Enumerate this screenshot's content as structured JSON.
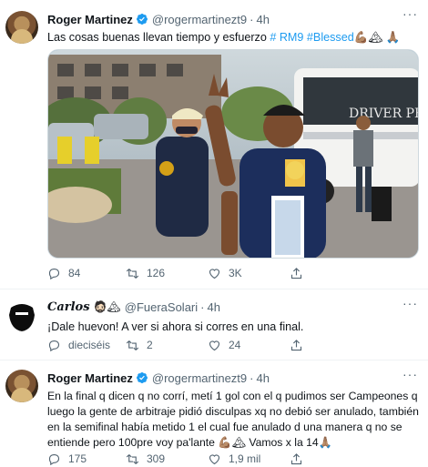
{
  "tweets": [
    {
      "name": "Roger Martinez",
      "handle": "@rogermartinezt9",
      "time": "4h",
      "text": "Las cosas buenas llevan tiempo y esfuerzo",
      "hashtags": "# RM9 #Blessed",
      "emojis": "💪🏽🏔 🙏🏽",
      "stats": {
        "replies": "84",
        "retweets": "126",
        "likes": "3K"
      }
    },
    {
      "name": "Carlos",
      "handle": "@FueraSolari",
      "time": "4h",
      "name_emojis": "🧔🏻🏔",
      "text": "¡Dale huevon! A ver si ahora si corres en una final.",
      "stats": {
        "replies": "dieciséis",
        "retweets": "2",
        "likes": "24"
      }
    },
    {
      "name": "Roger Martinez",
      "handle": "@rogermartinezt9",
      "time": "4h",
      "text_line1": "En la final q dicen q no corrí, metí 1 gol con el q pudimos ser Campeones q",
      "text_line2": "luego la gente de arbitraje pidió disculpas xq no debió ser anulado, también",
      "text_line3": "en la semifinal había metido 1 el cual fue anulado d una manera q no se",
      "text_line4": "entiende pero 100pre voy pa'lante 💪🏽🏔 Vamos x la 14🙏🏽",
      "stats": {
        "replies": "175",
        "retweets": "309",
        "likes": "1,9 mil"
      }
    }
  ],
  "media": {
    "bus_text": "DRIVER PR"
  },
  "colors": {
    "accent": "#1d9bf0",
    "secondary_text": "#536471"
  }
}
